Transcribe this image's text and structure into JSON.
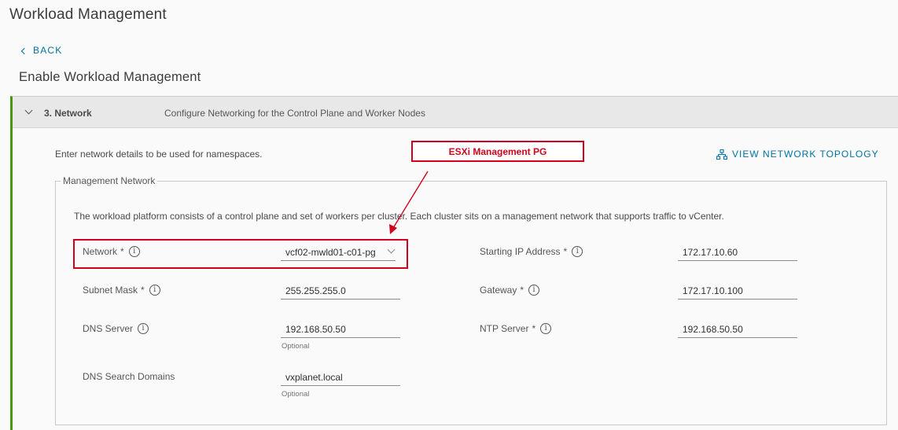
{
  "page": {
    "title": "Workload Management",
    "back_label": "BACK",
    "subtitle": "Enable Workload Management"
  },
  "step": {
    "label": "3. Network",
    "description": "Configure Networking for the Control Plane and Worker Nodes"
  },
  "intro_text": "Enter network details to be used for namespaces.",
  "topology_link": "VIEW NETWORK TOPOLOGY",
  "annotation": {
    "label": "ESXi Management PG",
    "color": "#d0021b"
  },
  "management_network": {
    "legend": "Management Network",
    "description": "The workload platform consists of a control plane and set of workers per cluster. Each cluster sits on a management network that supports traffic to vCenter.",
    "fields": {
      "network": {
        "label": "Network",
        "required": "*",
        "value": "vcf02-mwld01-c01-pg"
      },
      "subnet_mask": {
        "label": "Subnet Mask",
        "required": "*",
        "value": "255.255.255.0"
      },
      "dns_server": {
        "label": "DNS Server",
        "value": "192.168.50.50",
        "hint": "Optional"
      },
      "dns_search_domains": {
        "label": "DNS Search Domains",
        "value": "vxplanet.local",
        "hint": "Optional"
      },
      "starting_ip": {
        "label": "Starting IP Address",
        "required": "*",
        "value": "172.17.10.60"
      },
      "gateway": {
        "label": "Gateway",
        "required": "*",
        "value": "172.17.10.100"
      },
      "ntp_server": {
        "label": "NTP Server",
        "required": "*",
        "value": "192.168.50.50"
      }
    }
  },
  "info_glyph": "i",
  "colors": {
    "link": "#0072a3",
    "accent_bar": "#48960c",
    "annotation": "#d0021b"
  }
}
